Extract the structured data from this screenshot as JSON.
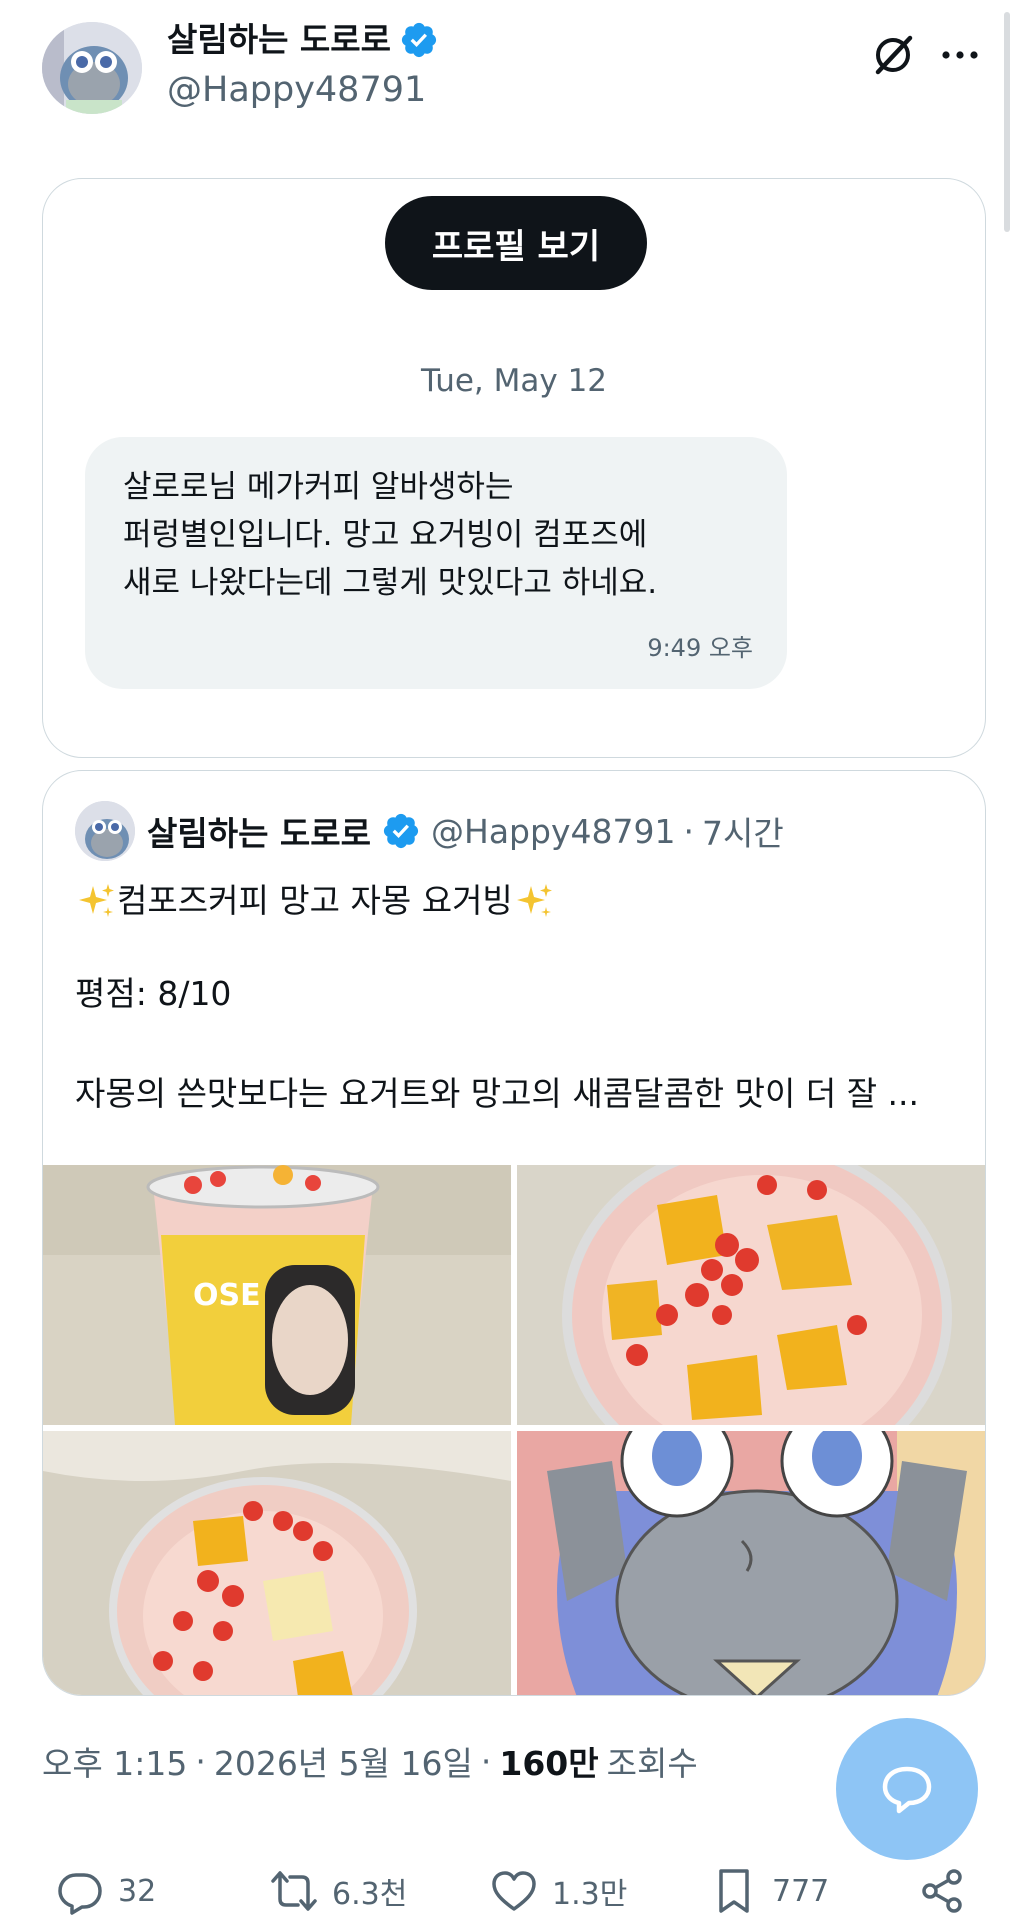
{
  "tweet_header": {
    "display_name": "살림하는 도로로",
    "handle": "@Happy48791",
    "verified_icon": "verified-badge-icon",
    "grok_icon": "grok-icon",
    "more_icon": "more-options-icon"
  },
  "chat_card": {
    "profile_button": "프로필 보기",
    "date": "Tue, May 12",
    "message": "살로로님 메가커피 알바생하는\n퍼렁별인입니다. 망고 요거빙이 컴포즈에\n새로 나왔다는데 그렇게 맛있다고 하네요.",
    "time": "9:49 오후"
  },
  "quoted_post": {
    "display_name": "살림하는 도로로",
    "handle": "@Happy48791",
    "separator": "·",
    "age": "7시간",
    "title": "컴포즈커피 망고 자몽 요거빙",
    "rating": "평점: 8/10",
    "body_preview": "자몽의 쓴맛보다는 요거트와 망고의 새콤달콤한 맛이 더 잘 ...",
    "photo_count": 4
  },
  "meta": {
    "time": "오후 1:15",
    "separator": "·",
    "date": "2026년 5월 16일",
    "views_count": "160만",
    "views_label": "조회수"
  },
  "actions": {
    "replies": "32",
    "reposts": "6.3천",
    "likes": "1.3만",
    "bookmarks": "777"
  },
  "colors": {
    "text_primary": "#0f1419",
    "text_secondary": "#536471",
    "verified_blue": "#1d9bf0",
    "border": "#cfd9de",
    "bubble_bg": "#eff3f4",
    "fab_bg": "#8ec5f5"
  }
}
